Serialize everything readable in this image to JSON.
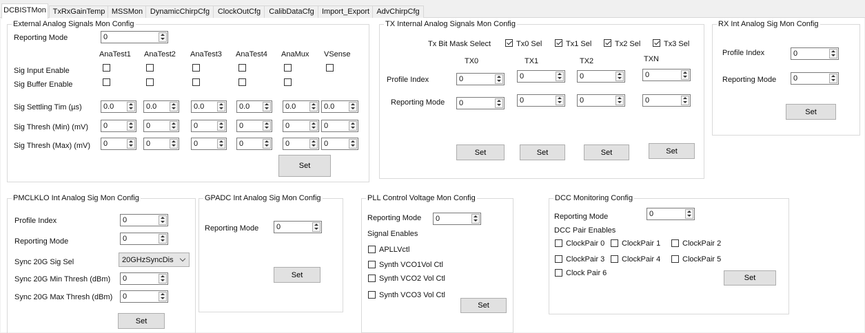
{
  "tabs": [
    "DCBISTMon",
    "TxRxGainTemp",
    "MSSMon",
    "DynamicChirpCfg",
    "ClockOutCfg",
    "CalibDataCfg",
    "Import_Export",
    "AdvChirpCfg"
  ],
  "ext": {
    "title": "External Analog Signals Mon Config",
    "reporting_mode_label": "Reporting Mode",
    "reporting_mode_value": "0",
    "columns": [
      "AnaTest1",
      "AnaTest2",
      "AnaTest3",
      "AnaTest4",
      "AnaMux",
      "VSense"
    ],
    "sig_input_enable_label": "Sig Input Enable",
    "sig_buffer_enable_label": "Sig Buffer Enable",
    "settling_label": "Sig Settling Tim (µs)",
    "settling_values": [
      "0.0",
      "0.0",
      "0.0",
      "0.0",
      "0.0",
      "0.0"
    ],
    "thresh_min_label": "Sig Thresh (Min) (mV)",
    "thresh_min_values": [
      "0",
      "0",
      "0",
      "0",
      "0",
      "0"
    ],
    "thresh_max_label": "Sig Thresh (Max) (mV)",
    "thresh_max_values": [
      "0",
      "0",
      "0",
      "0",
      "0",
      "0"
    ],
    "set_label": "Set"
  },
  "tx": {
    "title": "TX Internal Analog Signals Mon Config",
    "bitmask_label": "Tx Bit Mask Select",
    "sels": [
      "Tx0 Sel",
      "Tx1 Sel",
      "Tx2 Sel",
      "Tx3 Sel"
    ],
    "columns": [
      "TX0",
      "TX1",
      "TX2",
      "TXN"
    ],
    "profile_index_label": "Profile Index",
    "profile_index_values": [
      "0",
      "0",
      "0",
      "0"
    ],
    "reporting_mode_label": "Reporting Mode",
    "reporting_mode_values": [
      "0",
      "0",
      "0",
      "0"
    ],
    "set_label": "Set"
  },
  "rx": {
    "title": "RX Int Analog Sig Mon Config",
    "profile_index_label": "Profile Index",
    "profile_index_value": "0",
    "reporting_mode_label": "Reporting Mode",
    "reporting_mode_value": "0",
    "set_label": "Set"
  },
  "pmclklo": {
    "title": "PMCLKLO Int Analog Sig Mon Config",
    "profile_index_label": "Profile Index",
    "profile_index_value": "0",
    "reporting_mode_label": "Reporting Mode",
    "reporting_mode_value": "0",
    "sync_sel_label": "Sync 20G Sig Sel",
    "sync_sel_value": "20GHzSyncDis",
    "min_thresh_label": "Sync 20G Min Thresh (dBm)",
    "min_thresh_value": "0",
    "max_thresh_label": "Sync 20G Max Thresh (dBm)",
    "max_thresh_value": "0",
    "set_label": "Set"
  },
  "gpadc": {
    "title": "GPADC Int Analog Sig Mon Config",
    "reporting_mode_label": "Reporting Mode",
    "reporting_mode_value": "0",
    "set_label": "Set"
  },
  "pll": {
    "title": "PLL Control Voltage Mon Config",
    "reporting_mode_label": "Reporting Mode",
    "reporting_mode_value": "0",
    "signal_enables_label": "Signal Enables",
    "enables": [
      "APLLVctl",
      "Synth VCO1Vol Ctl",
      "Synth VCO2 Vol Ctl",
      "Synth VCO3 Vol Ctl"
    ],
    "set_label": "Set"
  },
  "dcc": {
    "title": "DCC Monitoring Config",
    "reporting_mode_label": "Reporting Mode",
    "reporting_mode_value": "0",
    "pair_enables_label": "DCC Pair Enables",
    "pairs": [
      "ClockPair 0",
      "ClockPair 1",
      "ClockPair 2",
      "ClockPair 3",
      "ClockPair 4",
      "ClockPair 5",
      "Clock Pair 6"
    ],
    "set_label": "Set"
  }
}
